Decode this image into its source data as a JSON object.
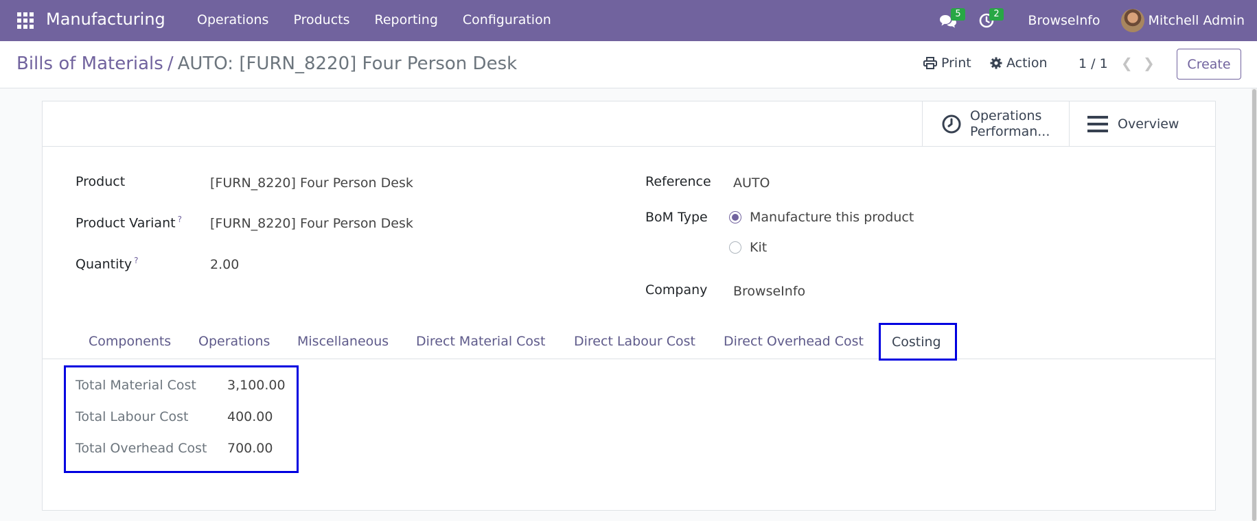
{
  "navbar": {
    "brand": "Manufacturing",
    "menu": [
      "Operations",
      "Products",
      "Reporting",
      "Configuration"
    ],
    "messages_badge": "5",
    "activities_badge": "2",
    "company": "BrowseInfo",
    "user": "Mitchell Admin"
  },
  "control": {
    "breadcrumb_parent": "Bills of Materials",
    "breadcrumb_sep": "/",
    "breadcrumb_current": "AUTO: [FURN_8220] Four Person Desk",
    "print_label": "Print",
    "action_label": "Action",
    "pager": "1 / 1",
    "create_label": "Create"
  },
  "smart_buttons": {
    "operations_line1": "Operations",
    "operations_line2": "Performan...",
    "overview": "Overview"
  },
  "form": {
    "product_label": "Product",
    "product_value": "[FURN_8220] Four Person Desk",
    "variant_label": "Product Variant",
    "variant_value": "[FURN_8220] Four Person Desk",
    "quantity_label": "Quantity",
    "quantity_value": "2.00",
    "help_mark": "?",
    "reference_label": "Reference",
    "reference_value": "AUTO",
    "bom_type_label": "BoM Type",
    "bom_type_options": [
      "Manufacture this product",
      "Kit"
    ],
    "company_label": "Company",
    "company_value": "BrowseInfo"
  },
  "tabs": [
    "Components",
    "Operations",
    "Miscellaneous",
    "Direct Material Cost",
    "Direct Labour Cost",
    "Direct Overhead Cost",
    "Costing"
  ],
  "costing": [
    {
      "label": "Total Material Cost",
      "value": "3,100.00"
    },
    {
      "label": "Total Labour Cost",
      "value": "400.00"
    },
    {
      "label": "Total Overhead Cost",
      "value": "700.00"
    }
  ],
  "colors": {
    "accent": "#71639e",
    "badge": "#28a745",
    "highlight": "#0000e0"
  }
}
